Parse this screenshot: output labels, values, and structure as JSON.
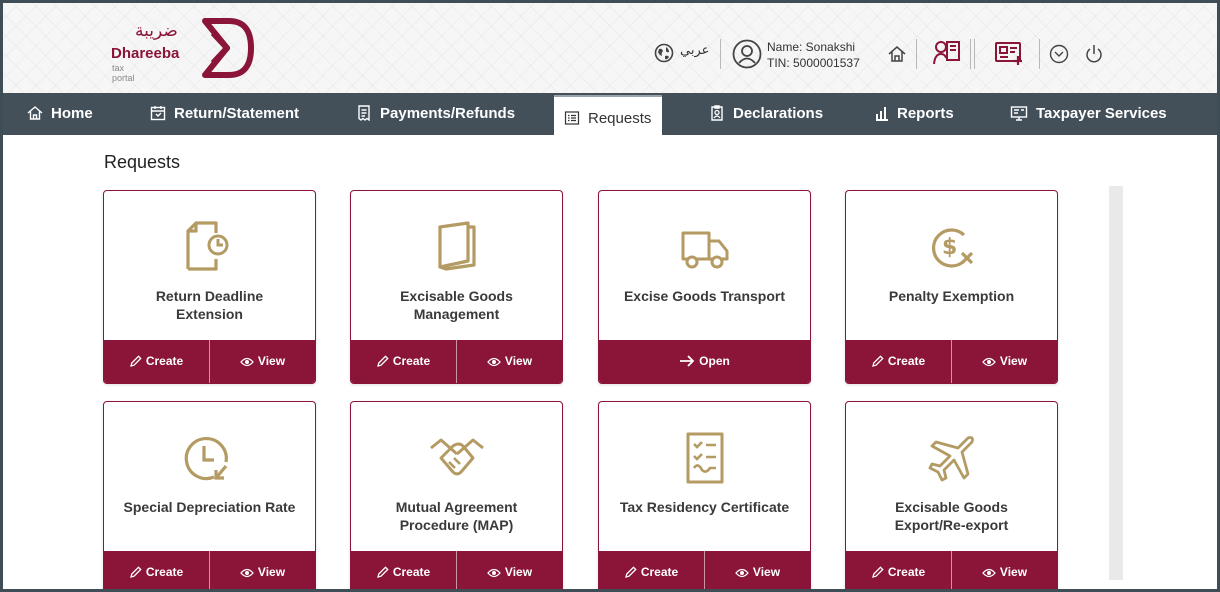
{
  "brand": {
    "arabic": "ضريبة",
    "name": "Dhareeba",
    "sub": "tax portal"
  },
  "header": {
    "language": "عربي",
    "user_name": "Name: Sonakshi",
    "user_tin": "TIN: 5000001537"
  },
  "nav": {
    "home": "Home",
    "return": "Return/Statement",
    "payments": "Payments/Refunds",
    "requests": "Requests",
    "declarations": "Declarations",
    "reports": "Reports",
    "taxpayer": "Taxpayer Services"
  },
  "page": {
    "title": "Requests"
  },
  "actions": {
    "create": "Create",
    "view": "View",
    "open": "Open"
  },
  "cards": [
    {
      "title1": "Return Deadline",
      "title2": "Extension",
      "icon": "document-clock-icon"
    },
    {
      "title1": "Excisable Goods",
      "title2": "Management",
      "icon": "book-icon"
    },
    {
      "title1": "Excise Goods Transport",
      "title2": "",
      "icon": "truck-icon"
    },
    {
      "title1": "Penalty Exemption",
      "title2": "",
      "icon": "dollar-cancel-icon"
    },
    {
      "title1": "Special Depreciation Rate",
      "title2": "",
      "icon": "clock-arrow-icon"
    },
    {
      "title1": "Mutual Agreement",
      "title2": "Procedure (MAP)",
      "icon": "handshake-icon"
    },
    {
      "title1": "Tax Residency Certificate",
      "title2": "",
      "icon": "checklist-icon"
    },
    {
      "title1": "Excisable Goods",
      "title2": "Export/Re-export",
      "icon": "airplane-icon"
    }
  ],
  "colors": {
    "brand": "#8a1538",
    "nav": "#434f59",
    "icon_gold": "#b49a63"
  }
}
